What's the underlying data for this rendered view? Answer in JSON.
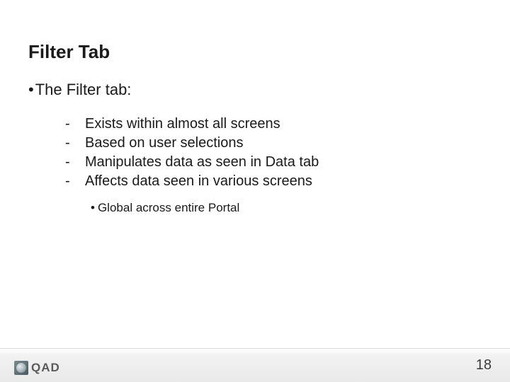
{
  "title": "Filter Tab",
  "main_bullet": "The Filter tab:",
  "items": [
    "Exists within almost all screens",
    "Based on user selections",
    "Manipulates data as seen in Data tab",
    "Affects data seen in various screens"
  ],
  "sub_item": "Global across entire Portal",
  "logo_text": "QAD",
  "page_number": "18"
}
